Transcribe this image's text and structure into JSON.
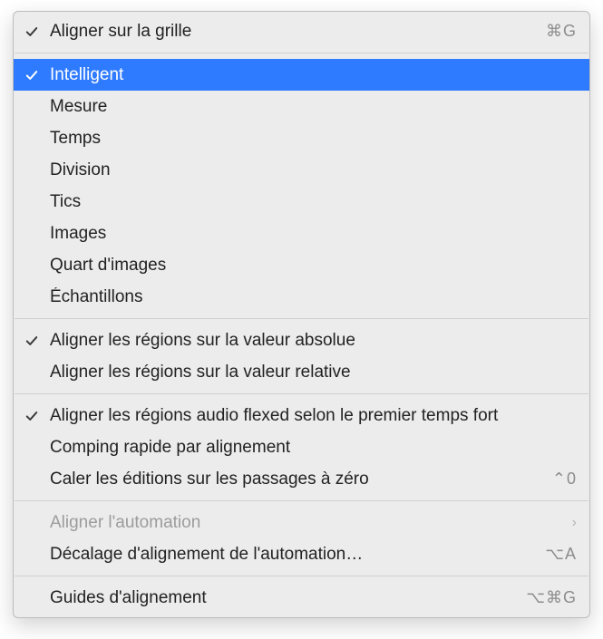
{
  "menu": {
    "groups": [
      [
        {
          "label": "Aligner sur la grille",
          "checked": true,
          "shortcut": "⌘G"
        }
      ],
      [
        {
          "label": "Intelligent",
          "checked": true,
          "selected": true
        },
        {
          "label": "Mesure"
        },
        {
          "label": "Temps"
        },
        {
          "label": "Division"
        },
        {
          "label": "Tics"
        },
        {
          "label": "Images"
        },
        {
          "label": "Quart d'images"
        },
        {
          "label": "Échantillons"
        }
      ],
      [
        {
          "label": "Aligner les régions sur la valeur absolue",
          "checked": true
        },
        {
          "label": "Aligner les régions sur la valeur relative"
        }
      ],
      [
        {
          "label": "Aligner les régions audio flexed selon le premier temps fort",
          "checked": true
        },
        {
          "label": "Comping rapide par alignement"
        },
        {
          "label": "Caler les éditions sur les passages à zéro",
          "shortcut": "⌃0"
        }
      ],
      [
        {
          "label": "Aligner l'automation",
          "disabled": true,
          "submenu": true
        },
        {
          "label": "Décalage d'alignement de l'automation…",
          "shortcut": "⌥A"
        }
      ],
      [
        {
          "label": "Guides d'alignement",
          "shortcut": "⌥⌘G"
        }
      ]
    ]
  },
  "icons": {
    "check": "check-icon",
    "chevron": "chevron-right-icon"
  }
}
